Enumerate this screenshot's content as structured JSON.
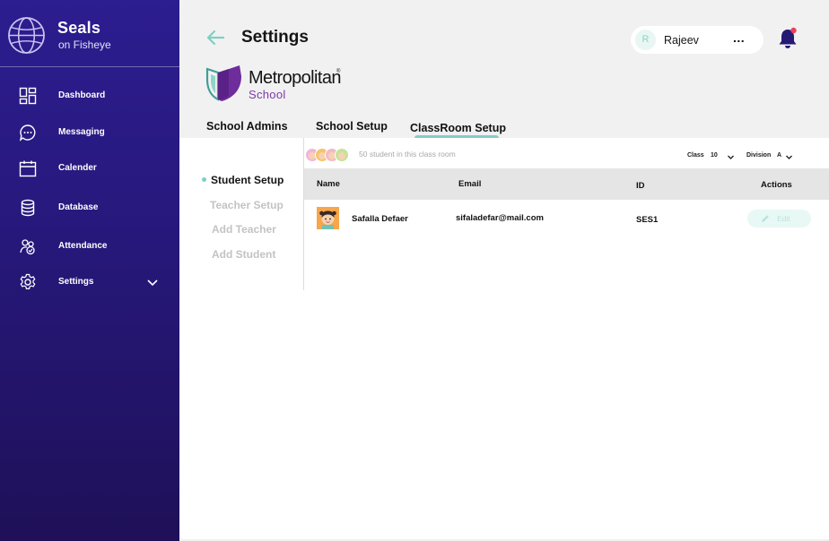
{
  "app": {
    "name": "Seals",
    "subtitle": "on Fisheye"
  },
  "sidebar": {
    "items": [
      {
        "label": "Dashboard",
        "icon": "dashboard-icon"
      },
      {
        "label": "Messaging",
        "icon": "chat-bubble-icon"
      },
      {
        "label": "Calender",
        "icon": "calendar-icon"
      },
      {
        "label": "Database",
        "icon": "database-icon"
      },
      {
        "label": "Attendance",
        "icon": "attendance-icon"
      },
      {
        "label": "Settings",
        "icon": "gear-icon"
      }
    ]
  },
  "header": {
    "title": "Settings",
    "user": {
      "initial": "R",
      "name": "Rajeev",
      "more": "..."
    }
  },
  "school": {
    "name": "Metropolitan",
    "registered": "®",
    "sub": "School"
  },
  "tabs": [
    "School Admins",
    "School Setup",
    "ClassRoom Setup"
  ],
  "active_tab": "ClassRoom Setup",
  "submenu": [
    "Student Setup",
    "Teacher Setup",
    "Add Teacher",
    "Add Student"
  ],
  "active_submenu": "Student Setup",
  "summary": {
    "count_text": "50 student in this class room"
  },
  "filters": {
    "class_label": "Class",
    "class_value": "10",
    "division_label": "Division",
    "division_value": "A"
  },
  "table": {
    "columns": [
      "Name",
      "Email",
      "ID",
      "Actions"
    ],
    "rows": [
      {
        "name": "Safalla Defaer",
        "email": "sifaladefar@mail.com",
        "id": "SES1",
        "action": "Edit"
      }
    ]
  },
  "colors": {
    "sidebar_top": "#2c1d90",
    "sidebar_bottom": "#1f1058",
    "accent": "#7fcfc3",
    "notification_dot": "#e8435a"
  }
}
